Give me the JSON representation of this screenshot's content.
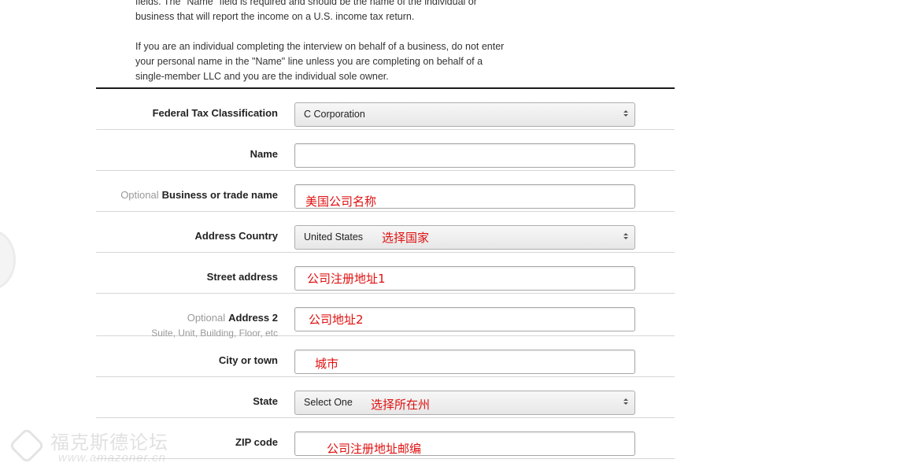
{
  "intro": {
    "paragraph1": "fields. The \"Name\" field is required and should be the name of the individual or business that will report the income on a U.S. income tax return.",
    "paragraph2": "If you are an individual completing the interview on behalf of a business, do not enter your personal name in the \"Name\" line unless you are completing on behalf of a single-member LLC and you are the individual sole owner."
  },
  "optional_label": "Optional",
  "fields": {
    "tax_classification": {
      "label": "Federal Tax Classification",
      "value": "C Corporation"
    },
    "name": {
      "label": "Name",
      "value": ""
    },
    "business_name": {
      "label": "Business or trade name",
      "value": "",
      "annotation": "美国公司名称"
    },
    "address_country": {
      "label": "Address Country",
      "value": "United States",
      "annotation": "选择国家"
    },
    "street_address": {
      "label": "Street address",
      "value": "",
      "annotation": "公司注册地址1"
    },
    "address2": {
      "label": "Address 2",
      "hint": "Suite, Unit, Building, Floor, etc",
      "value": "",
      "annotation": "公司地址2"
    },
    "city": {
      "label": "City or town",
      "value": "",
      "annotation": "城市"
    },
    "state": {
      "label": "State",
      "value": "Select One",
      "annotation": "选择所在州"
    },
    "zip": {
      "label": "ZIP code",
      "value": "",
      "annotation": "公司注册地址邮编"
    }
  },
  "watermark": {
    "title": "福克斯德论坛",
    "url": "www.amazoner.cn"
  },
  "colors": {
    "annotation": "#e01010",
    "divider": "#d6d6d6"
  }
}
